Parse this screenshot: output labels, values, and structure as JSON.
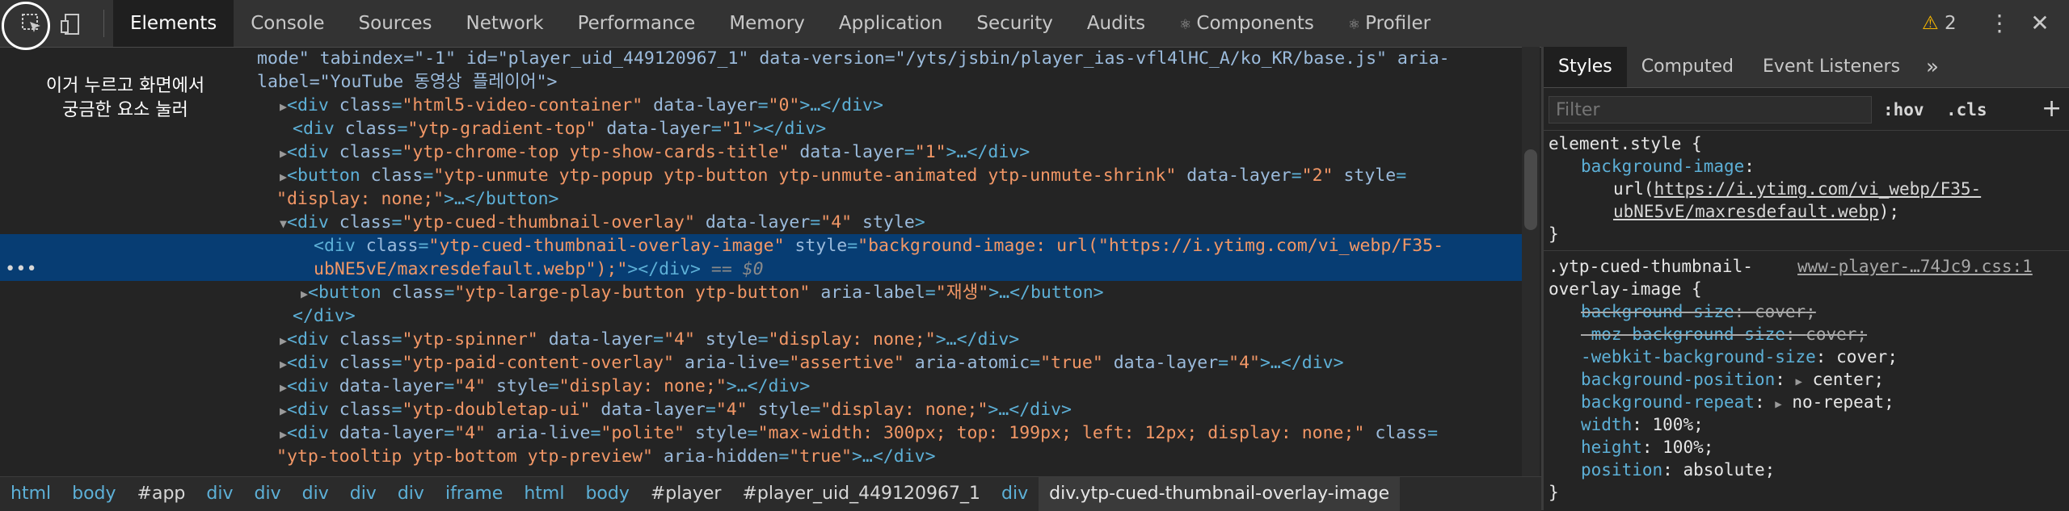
{
  "toolbar": {
    "tabs": [
      "Elements",
      "Console",
      "Sources",
      "Network",
      "Performance",
      "Memory",
      "Application",
      "Security",
      "Audits",
      "Components",
      "Profiler"
    ],
    "react_glyph": "⚛",
    "warning_count": "2",
    "kebab": "⋮",
    "close": "✕"
  },
  "annotation": {
    "line1": "이거 누르고 화면에서",
    "line2": "궁금한 요소 눌러"
  },
  "tree": {
    "l0a": "mode\" tabindex=\"-1\" id=\"player_uid_449120967_1\" data-version=\"/yts/jsbin/player_ias-vfl4lHC_A/ko_KR/base.js\" aria-",
    "l0b": "label=\"YouTube 동영상 플레이어\">",
    "l1": {
      "tag": "div",
      "attrs": [
        [
          "class",
          "html5-video-container"
        ],
        [
          "data-layer",
          "0"
        ]
      ],
      "tail": ">…</div>"
    },
    "l2": {
      "tag": "div",
      "attrs": [
        [
          "class",
          "ytp-gradient-top"
        ],
        [
          "data-layer",
          "1"
        ]
      ],
      "tail": "></div>"
    },
    "l3": {
      "tag": "div",
      "attrs": [
        [
          "class",
          "ytp-chrome-top ytp-show-cards-title"
        ],
        [
          "data-layer",
          "1"
        ]
      ],
      "tail": ">…</div>"
    },
    "l4a": "button",
    "l4_class": "ytp-unmute ytp-popup ytp-button ytp-unmute-animated ytp-unmute-shrink",
    "l4_layer": "2",
    "l4b_style": "display: none;",
    "l4b_tail": ">…</button>",
    "l5": {
      "tag": "div",
      "class": "ytp-cued-thumbnail-overlay",
      "layer": "4"
    },
    "sel_class": "ytp-cued-thumbnail-overlay-image",
    "sel_style_a": "background-image: url(\"https://i.ytimg.com/vi_webp/F35-",
    "sel_style_b": "ubNE5vE/maxresdefault.webp\");",
    "sel_eq": "== $0",
    "l7_class": "ytp-large-play-button ytp-button",
    "l7_label": "재생",
    "l8": "</div>",
    "l9_class": "ytp-spinner",
    "l9_layer": "4",
    "l9_style": "display: none;",
    "l10_class": "ytp-paid-content-overlay",
    "l10_live": "assertive",
    "l10_atomic": "true",
    "l10_layer": "4",
    "l11_layer": "4",
    "l11_style": "display: none;",
    "l12_class": "ytp-doubletap-ui",
    "l12_layer": "4",
    "l12_style": "display: none;",
    "l13_layer": "4",
    "l13_live": "polite",
    "l13_style": "max-width: 300px; top: 199px; left: 12px; display: none;",
    "l14_class": "ytp-tooltip ytp-bottom ytp-preview",
    "l14_hidden": "true"
  },
  "breadcrumbs": [
    "html",
    "body",
    "#app",
    "div",
    "div",
    "div",
    "div",
    "div",
    "iframe",
    "html",
    "body",
    "#player",
    "#player_uid_449120967_1",
    "div",
    "div.ytp-cued-thumbnail-overlay-image"
  ],
  "styles": {
    "tabs": [
      "Styles",
      "Computed",
      "Event Listeners"
    ],
    "more": "»",
    "filter_placeholder": "Filter",
    "hov": ":hov",
    "cls": ".cls",
    "plus": "+",
    "element_style": "element.style {",
    "bg_image_prop": "background-image",
    "bg_image_url": "https://i.ytimg.com/vi_webp/F35-ubNE5vE/maxresdefault.webp",
    "bg_url_l1": "https://i.ytimg.com/vi_webp/F35-",
    "bg_url_l2": "ubNE5vE/maxresdefault.webp",
    "rule2_sel_l1": ".ytp-cued-thumbnail-",
    "rule2_sel_l2": "overlay-image {",
    "rule2_src": "www-player-…74Jc9.css:1",
    "decls": [
      {
        "prop": "background-size",
        "val": "cover",
        "struck": true
      },
      {
        "prop": "-moz-background-size",
        "val": "cover",
        "struck": true
      },
      {
        "prop": "-webkit-background-size",
        "val": "cover",
        "struck": false
      },
      {
        "prop": "background-position",
        "val": "center",
        "struck": false
      },
      {
        "prop": "background-repeat",
        "val": "no-repeat",
        "struck": false
      },
      {
        "prop": "width",
        "val": "100%",
        "struck": false
      },
      {
        "prop": "height",
        "val": "100%",
        "struck": false
      },
      {
        "prop": "position",
        "val": "absolute",
        "struck": false
      }
    ]
  }
}
